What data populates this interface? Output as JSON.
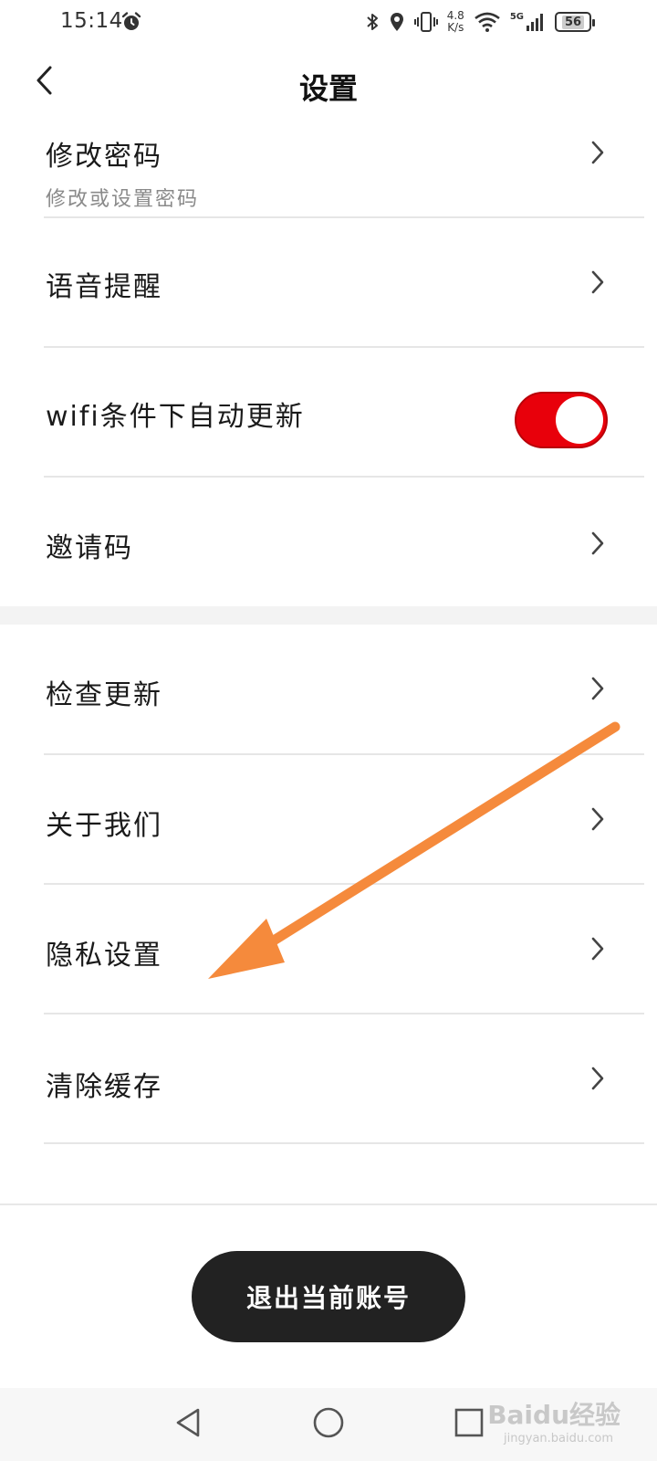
{
  "status_bar": {
    "time": "15:14",
    "network_speed_value": "4.8",
    "network_speed_unit": "K/s",
    "network_type": "5G",
    "battery": "56"
  },
  "header": {
    "title": "设置"
  },
  "settings": {
    "change_password": {
      "label": "修改密码",
      "subtitle": "修改或设置密码"
    },
    "voice_reminder": {
      "label": "语音提醒"
    },
    "wifi_auto_update": {
      "label": "wifi条件下自动更新",
      "enabled": true
    },
    "invite_code": {
      "label": "邀请码"
    },
    "check_update": {
      "label": "检查更新"
    },
    "about_us": {
      "label": "关于我们"
    },
    "privacy_settings": {
      "label": "隐私设置"
    },
    "clear_cache": {
      "label": "清除缓存"
    }
  },
  "logout_button": {
    "label": "退出当前账号"
  },
  "watermark": {
    "brand": "Baidu经验",
    "url": "jingyan.baidu.com"
  },
  "colors": {
    "toggle_on": "#e8000b",
    "button_bg": "#222222",
    "annotation_arrow": "#f58a3c"
  }
}
